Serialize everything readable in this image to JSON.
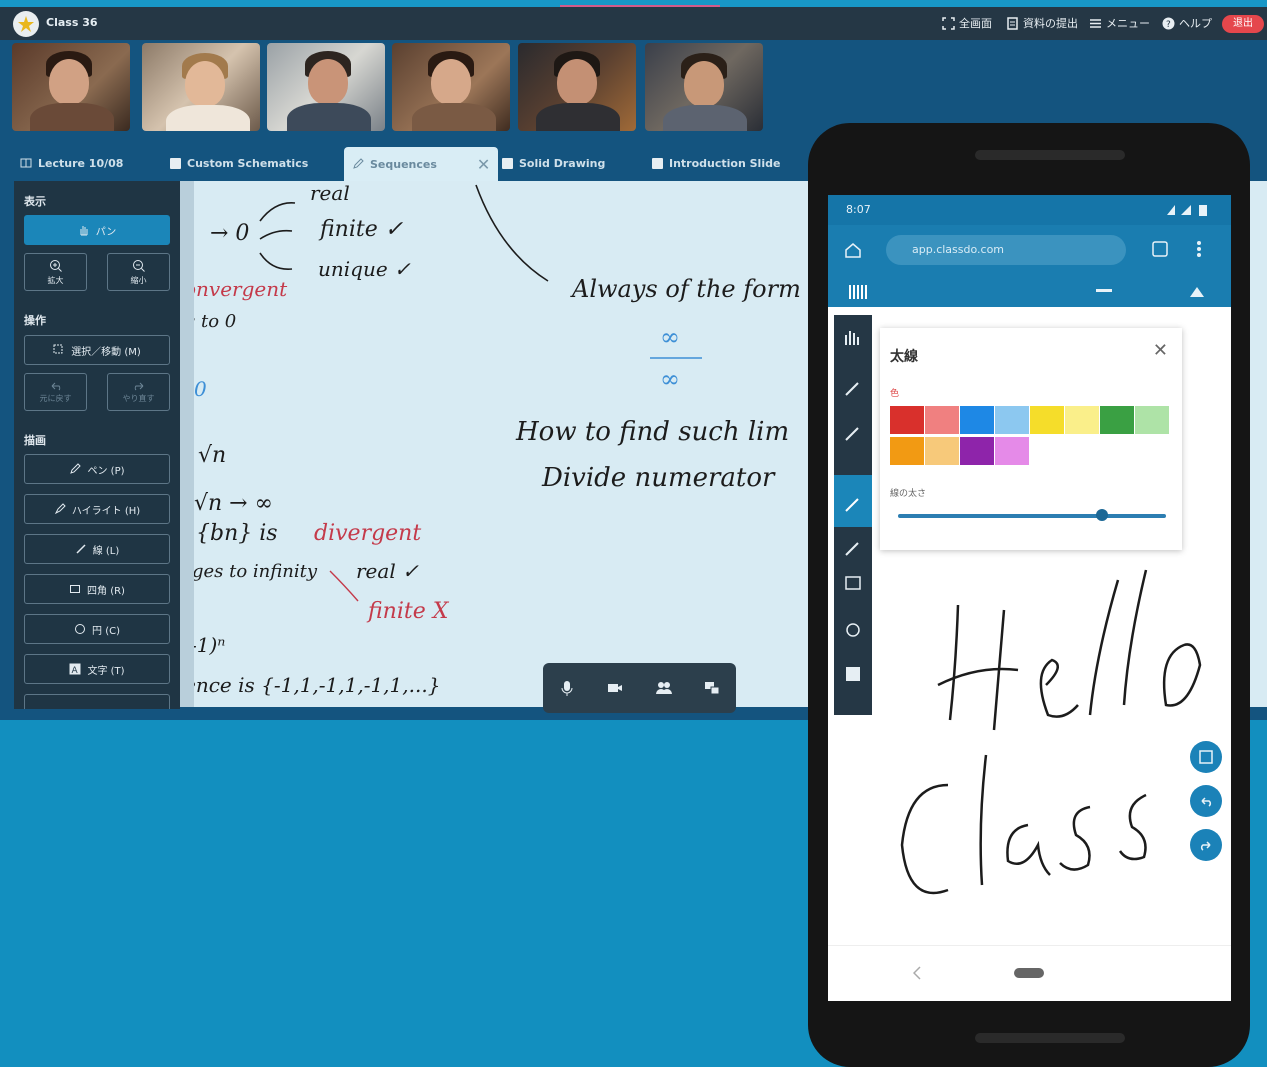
{
  "app": {
    "name": "Class 36",
    "toolbar": {
      "fullscreen": "全画面",
      "materials": "資料の提出",
      "menu": "メニュー",
      "help": "ヘルプ",
      "leave": "退出"
    }
  },
  "participants": [
    "participant-1",
    "participant-2",
    "participant-3",
    "participant-4",
    "participant-5",
    "participant-6"
  ],
  "tabs": [
    {
      "label": "Lecture 10/08"
    },
    {
      "label": "Custom Schematics"
    },
    {
      "label": "Sequences"
    },
    {
      "label": "Solid Drawing"
    },
    {
      "label": "Introduction Slide"
    }
  ],
  "panel": {
    "display_heading": "表示",
    "pan": "パン",
    "zoom_in": "拡大",
    "zoom_out": "縮小",
    "operation_heading": "操作",
    "select_move": "選択／移動 (M)",
    "undo": "元に戻す",
    "redo": "やり直す",
    "draw_heading": "描画",
    "pen": "ペン (P)",
    "highlight": "ハイライト (H)",
    "line": "線 (L)",
    "rect": "四角 (R)",
    "circle": "円 (C)",
    "text": "文字 (T)"
  },
  "board": {
    "notes": [
      "real",
      "→ 0",
      "finite ✓",
      "unique ✓",
      "onvergent",
      "s to 0",
      "0",
      "Always of the form",
      "∞",
      "∞",
      "How to find such lim",
      "Divide numerator",
      "√n",
      "√n → ∞",
      "{bn} is",
      "divergent",
      "ges to infinity",
      "real ✓",
      "finite X",
      "-1)ⁿ",
      "ence is {-1,1,-1,1,-1,1,...}"
    ]
  },
  "phone": {
    "time": "8:07",
    "url": "app.classdo.com",
    "palette": {
      "title": "太線",
      "color_label": "色",
      "width_label": "線の太さ",
      "width_value": 0.76,
      "swatches": [
        "#d9302c",
        "#f08080",
        "#1e88e5",
        "#8cc8f0",
        "#f5dd2a",
        "#faef8a",
        "#3aa043",
        "#aee3a7",
        "#f29a13",
        "#f7c97a",
        "#8e24aa",
        "#e58ae8"
      ]
    },
    "canvas_text": [
      "Hello",
      "Class"
    ]
  },
  "colors": {
    "accent": "#1b86b9",
    "background": "#128fbf",
    "leave": "#e5474c"
  }
}
